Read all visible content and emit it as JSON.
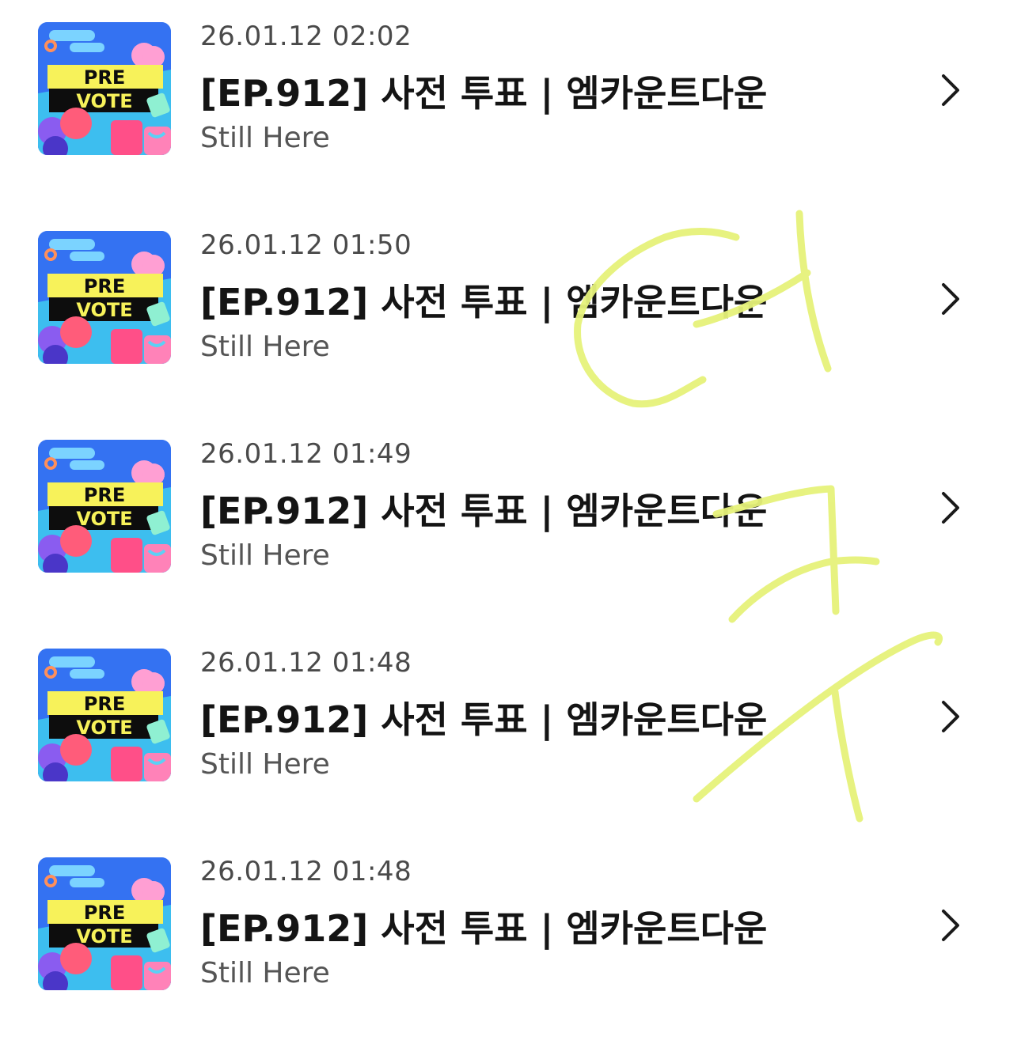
{
  "items": [
    {
      "date": "26.01.12 02:02",
      "title": "[EP.912] 사전 투표 | 엠카운트다운",
      "artist": "Still Here",
      "thumb_text_1": "PRE",
      "thumb_text_2": "VOTE"
    },
    {
      "date": "26.01.12 01:50",
      "title": "[EP.912] 사전 투표 | 엠카운트다운",
      "artist": "Still Here",
      "thumb_text_1": "PRE",
      "thumb_text_2": "VOTE"
    },
    {
      "date": "26.01.12 01:49",
      "title": "[EP.912] 사전 투표 | 엠카운트다운",
      "artist": "Still Here",
      "thumb_text_1": "PRE",
      "thumb_text_2": "VOTE"
    },
    {
      "date": "26.01.12 01:48",
      "title": "[EP.912] 사전 투표 | 엠카운트다운",
      "artist": "Still Here",
      "thumb_text_1": "PRE",
      "thumb_text_2": "VOTE"
    },
    {
      "date": "26.01.12 01:48",
      "title": "[EP.912] 사전 투표 | 엠카운트다운",
      "artist": "Still Here",
      "thumb_text_1": "PRE",
      "thumb_text_2": "VOTE"
    }
  ],
  "icons": {
    "row_action": "chevron-right-icon"
  },
  "colors": {
    "scribble": "#e6f27a",
    "thumb_yellow": "#f7f25a",
    "title": "#141414",
    "date": "#4a4a4a",
    "artist": "#555555"
  }
}
